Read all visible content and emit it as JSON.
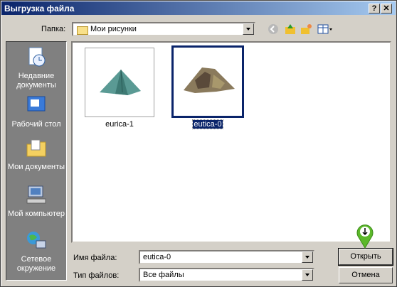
{
  "window": {
    "title": "Выгрузка файла",
    "help_btn": "?",
    "close_btn": "✕"
  },
  "toolbar": {
    "folder_label": "Папка:",
    "folder_value": "Мои рисунки"
  },
  "places": [
    {
      "label": "Недавние документы"
    },
    {
      "label": "Рабочий стол"
    },
    {
      "label": "Мои документы"
    },
    {
      "label": "Мой компьютер"
    },
    {
      "label": "Сетевое окружение"
    }
  ],
  "files": [
    {
      "name": "eurica-1",
      "selected": false
    },
    {
      "name": "eutica-0",
      "selected": true
    }
  ],
  "form": {
    "filename_label": "Имя файла:",
    "filename_value": "eutica-0",
    "filetype_label": "Тип файлов:",
    "filetype_value": "Все файлы"
  },
  "buttons": {
    "open": "Открыть",
    "cancel": "Отмена"
  },
  "colors": {
    "titlebar": "#0a246a",
    "selection": "#0a246a",
    "cursor_marker": "#5cb82a"
  }
}
